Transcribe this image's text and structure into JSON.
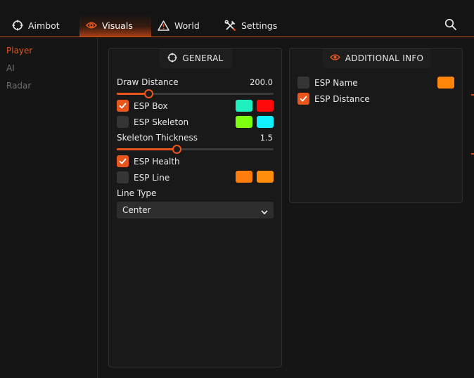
{
  "tabs": [
    {
      "label": "Aimbot",
      "icon": "crosshair-icon",
      "active": false
    },
    {
      "label": "Visuals",
      "icon": "eye-icon",
      "active": true
    },
    {
      "label": "World",
      "icon": "warning-triangle-icon",
      "active": false
    },
    {
      "label": "Settings",
      "icon": "tools-icon",
      "active": false
    }
  ],
  "search": {
    "icon": "search-icon"
  },
  "sidebar": {
    "items": [
      {
        "label": "Player",
        "active": true
      },
      {
        "label": "AI",
        "active": false
      },
      {
        "label": "Radar",
        "active": false
      }
    ]
  },
  "general": {
    "title": "GENERAL",
    "draw_distance": {
      "label": "Draw Distance",
      "value": "200.0",
      "fill_fraction": 0.2
    },
    "esp_box": {
      "label": "ESP Box",
      "checked": true,
      "colors": [
        "#1ff0c0",
        "#ff0a0a"
      ]
    },
    "esp_skeleton": {
      "label": "ESP Skeleton",
      "checked": false,
      "colors": [
        "#7fff10",
        "#10f0ff"
      ]
    },
    "skeleton_thickness": {
      "label": "Skeleton Thickness",
      "value": "1.5",
      "fill_fraction": 0.38
    },
    "esp_health": {
      "label": "ESP Health",
      "checked": true
    },
    "esp_line": {
      "label": "ESP Line",
      "checked": false,
      "colors": [
        "#ff7d0a",
        "#ff8c0a"
      ]
    },
    "line_type": {
      "label": "Line Type",
      "selected": "Center"
    }
  },
  "additional": {
    "title": "ADDITIONAL INFO",
    "esp_name": {
      "label": "ESP Name",
      "checked": false,
      "color": "#ff850a"
    },
    "esp_distance": {
      "label": "ESP Distance",
      "checked": true
    }
  },
  "colors": {
    "accent": "#e8561e",
    "background": "#151515",
    "panel": "#191919"
  }
}
